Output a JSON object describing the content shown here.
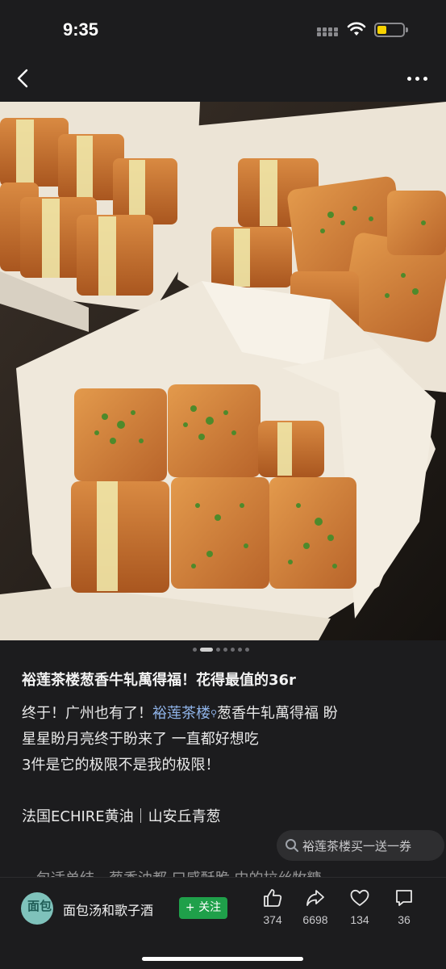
{
  "status_bar": {
    "time": "9:35"
  },
  "photo": {
    "description_icon": "food-photo"
  },
  "carousel": {
    "total": 7,
    "active_index": 1
  },
  "post": {
    "title": "裕莲茶楼葱香牛轧萬得福！花得最值的36r",
    "line1_prefix": "终于！广州也有了！",
    "line1_tag": "裕莲茶楼",
    "line1_suffix": "葱香牛轧萬得福 盼",
    "line2": "星星盼月亮终于盼来了 一直都好想吃",
    "line3": "3件是它的极限不是我的极限！",
    "line4": "法国ECHIRE黄油｜山安丘青葱",
    "line5_cut": "一包适单结一葱香油都  口感酥脆  中的拉丝牧糖"
  },
  "search_suggestion": {
    "text": "裕莲茶楼买一送一券"
  },
  "author": {
    "name": "面包汤和歌子酒",
    "avatar_text": "面包",
    "follow_label": "+ 关注"
  },
  "actions": {
    "like_count": "374",
    "share_count": "6698",
    "favorite_count": "134",
    "comment_count": "36"
  },
  "colors": {
    "accent_follow": "#1fa04a",
    "link": "#8fb3e8",
    "background": "#1c1c1e"
  }
}
